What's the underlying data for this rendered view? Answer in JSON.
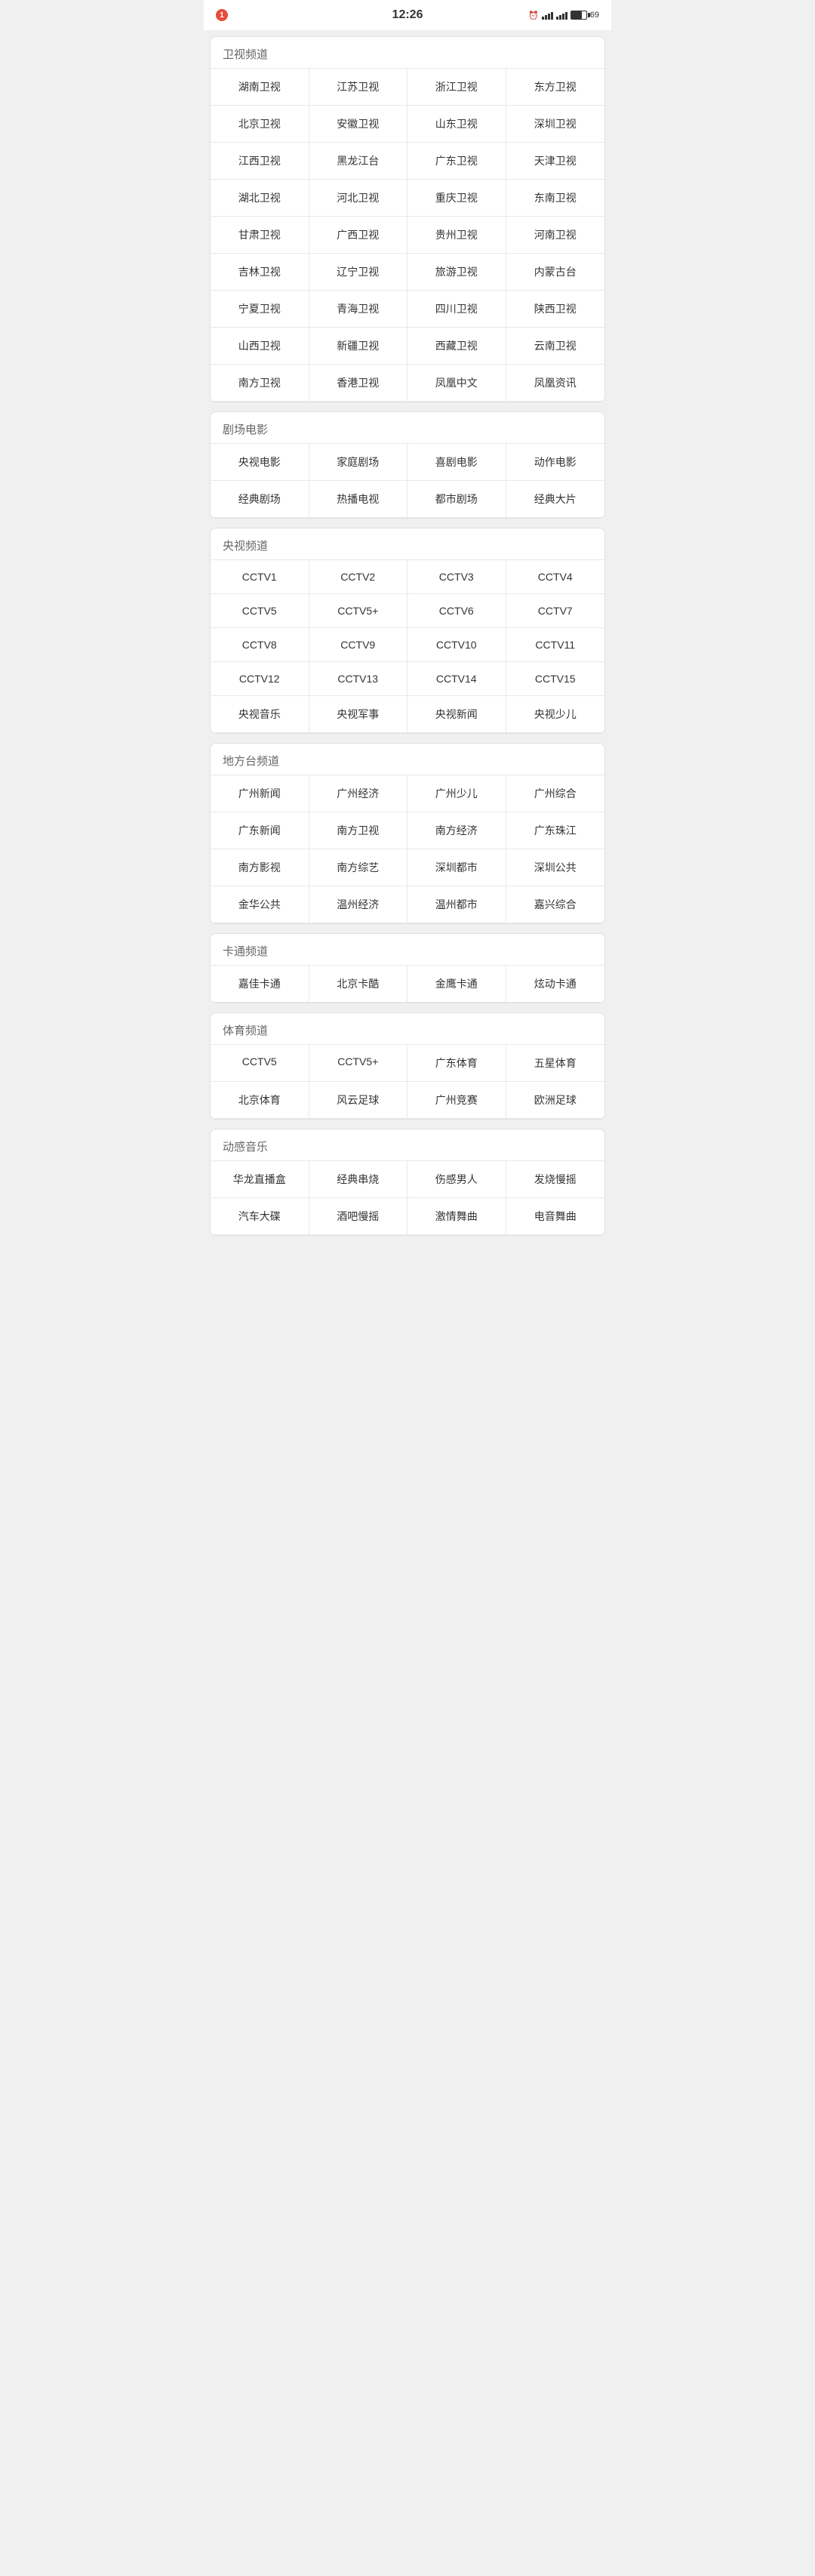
{
  "statusBar": {
    "time": "12:26",
    "notification": "1",
    "battery": "69"
  },
  "sections": [
    {
      "id": "satellite",
      "title": "卫视频道",
      "items": [
        "湖南卫视",
        "江苏卫视",
        "浙江卫视",
        "东方卫视",
        "北京卫视",
        "安徽卫视",
        "山东卫视",
        "深圳卫视",
        "江西卫视",
        "黑龙江台",
        "广东卫视",
        "天津卫视",
        "湖北卫视",
        "河北卫视",
        "重庆卫视",
        "东南卫视",
        "甘肃卫视",
        "广西卫视",
        "贵州卫视",
        "河南卫视",
        "吉林卫视",
        "辽宁卫视",
        "旅游卫视",
        "内蒙古台",
        "宁夏卫视",
        "青海卫视",
        "四川卫视",
        "陕西卫视",
        "山西卫视",
        "新疆卫视",
        "西藏卫视",
        "云南卫视",
        "南方卫视",
        "香港卫视",
        "凤凰中文",
        "凤凰资讯"
      ]
    },
    {
      "id": "drama-movies",
      "title": "剧场电影",
      "items": [
        "央视电影",
        "家庭剧场",
        "喜剧电影",
        "动作电影",
        "经典剧场",
        "热播电视",
        "都市剧场",
        "经典大片"
      ]
    },
    {
      "id": "cctv",
      "title": "央视频道",
      "items": [
        "CCTV1",
        "CCTV2",
        "CCTV3",
        "CCTV4",
        "CCTV5",
        "CCTV5+",
        "CCTV6",
        "CCTV7",
        "CCTV8",
        "CCTV9",
        "CCTV10",
        "CCTV11",
        "CCTV12",
        "CCTV13",
        "CCTV14",
        "CCTV15",
        "央视音乐",
        "央视军事",
        "央视新闻",
        "央视少儿"
      ]
    },
    {
      "id": "local",
      "title": "地方台频道",
      "items": [
        "广州新闻",
        "广州经济",
        "广州少儿",
        "广州综合",
        "广东新闻",
        "南方卫视",
        "南方经济",
        "广东珠江",
        "南方影视",
        "南方综艺",
        "深圳都市",
        "深圳公共",
        "金华公共",
        "温州经济",
        "温州都市",
        "嘉兴综合"
      ]
    },
    {
      "id": "cartoon",
      "title": "卡通频道",
      "items": [
        "嘉佳卡通",
        "北京卡酷",
        "金鹰卡通",
        "炫动卡通"
      ]
    },
    {
      "id": "sports",
      "title": "体育频道",
      "items": [
        "CCTV5",
        "CCTV5+",
        "广东体育",
        "五星体育",
        "北京体育",
        "风云足球",
        "广州竞赛",
        "欧洲足球"
      ]
    },
    {
      "id": "music",
      "title": "动感音乐",
      "items": [
        "华龙直播盒",
        "经典串烧",
        "伤感男人",
        "发烧慢摇",
        "汽车大碟",
        "酒吧慢摇",
        "激情舞曲",
        "电音舞曲"
      ]
    }
  ]
}
